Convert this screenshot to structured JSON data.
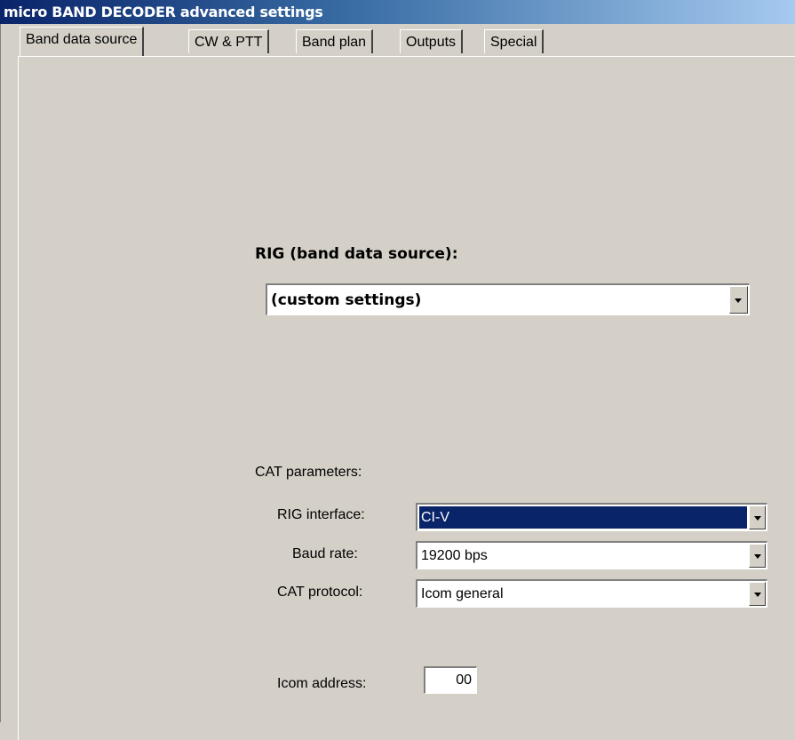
{
  "window": {
    "title": "micro BAND DECODER advanced settings"
  },
  "tabs": [
    {
      "label": "Band data source",
      "active": true
    },
    {
      "label": "CW & PTT",
      "active": false
    },
    {
      "label": "Band plan",
      "active": false
    },
    {
      "label": "Outputs",
      "active": false
    },
    {
      "label": "Special",
      "active": false
    }
  ],
  "band_data_source": {
    "rig_label": "RIG (band data source):",
    "rig_value": "(custom settings)",
    "cat_header": "CAT parameters:",
    "rig_interface": {
      "label": "RIG interface:",
      "value": "CI-V"
    },
    "baud_rate": {
      "label": "Baud rate:",
      "value": "19200 bps"
    },
    "cat_protocol": {
      "label": "CAT protocol:",
      "value": "Icom general"
    },
    "icom_address": {
      "label": "Icom address:",
      "value": "00"
    }
  },
  "colors": {
    "selection": "#0a246a",
    "face": "#d4d0c8"
  },
  "icons": {
    "dropdown": "chevron-down-icon"
  }
}
